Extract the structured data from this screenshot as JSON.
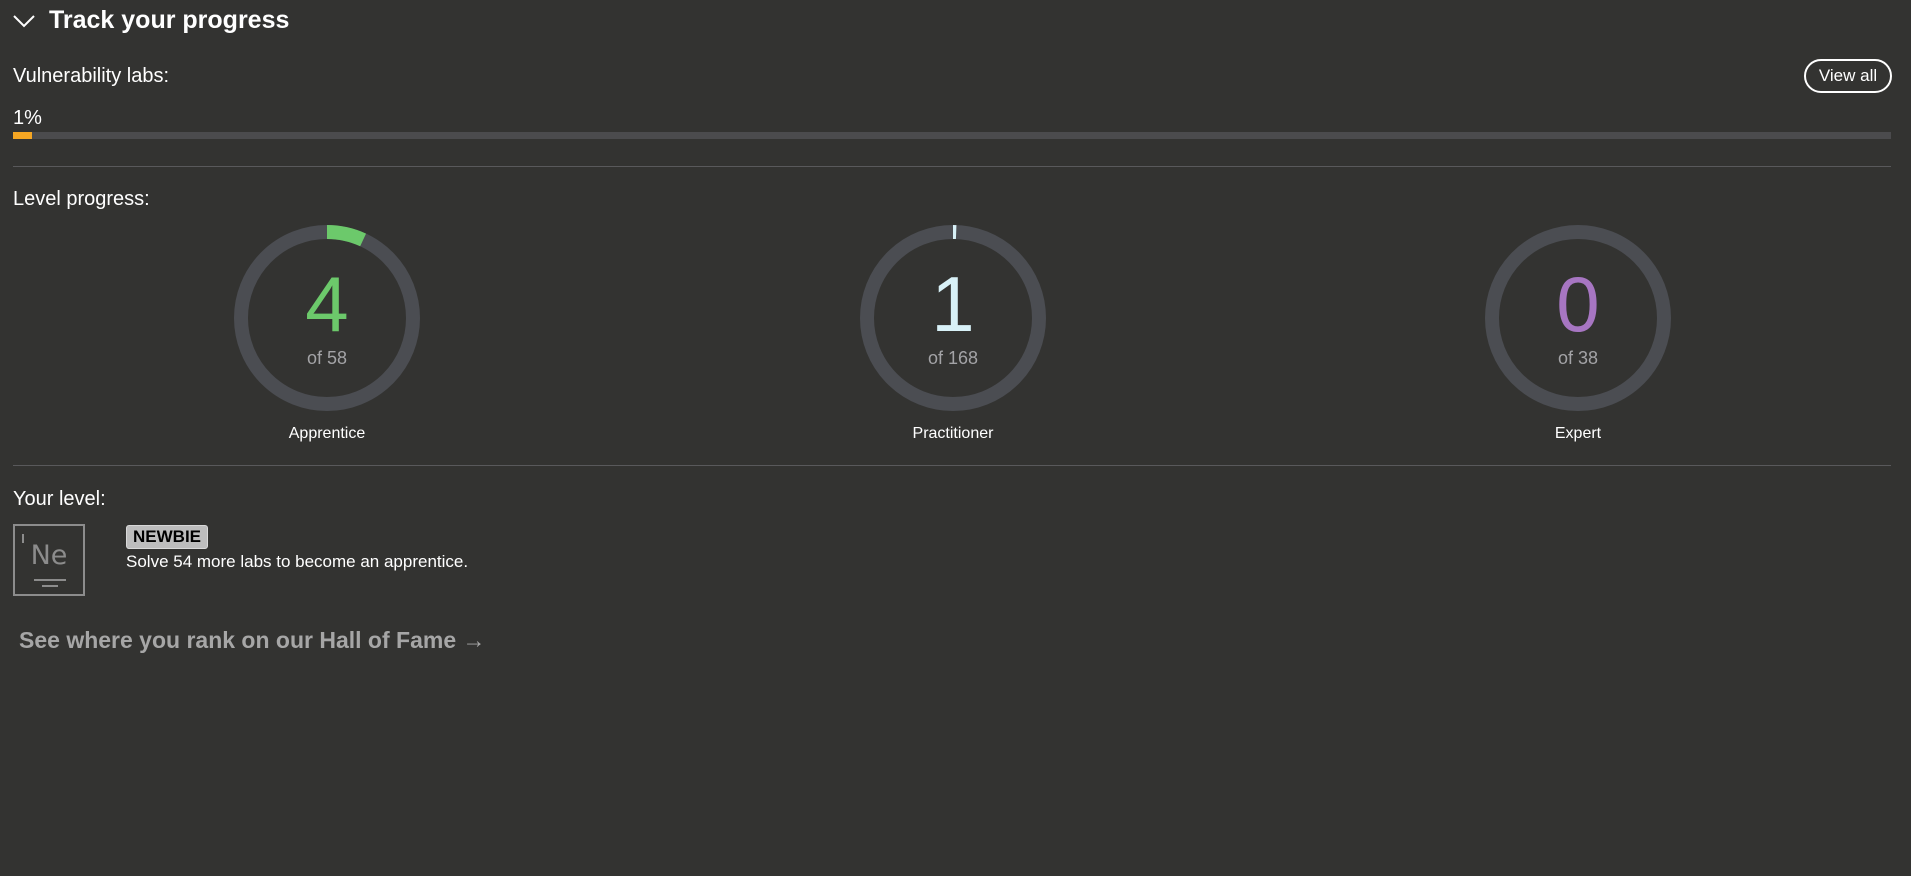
{
  "header": {
    "title": "Track your progress",
    "chevron_icon": "chevron-down-icon"
  },
  "vulnerability_labs": {
    "label": "Vulnerability labs:",
    "view_all_label": "View all",
    "percent_text": "1%",
    "progress_fraction": 0.01,
    "fill_color": "#f5a623"
  },
  "level_progress": {
    "label": "Level progress:",
    "levels": [
      {
        "name": "Apprentice",
        "solved": "4",
        "total_text": "of 58",
        "solved_value": 4,
        "total_value": 58,
        "color": "#6cc96b"
      },
      {
        "name": "Practitioner",
        "solved": "1",
        "total_text": "of 168",
        "solved_value": 1,
        "total_value": 168,
        "color": "#d8f1f7"
      },
      {
        "name": "Expert",
        "solved": "0",
        "total_text": "of 38",
        "solved_value": 0,
        "total_value": 38,
        "color": "#a776c2"
      }
    ],
    "ring_track_color": "#4b4d52"
  },
  "your_level": {
    "label": "Your level:",
    "badge_symbol": "Ne",
    "badge_name": "NEWBIE",
    "description": "Solve 54 more labs to become an apprentice."
  },
  "hall_of_fame": {
    "link_text": "See where you rank on our Hall of Fame →"
  }
}
